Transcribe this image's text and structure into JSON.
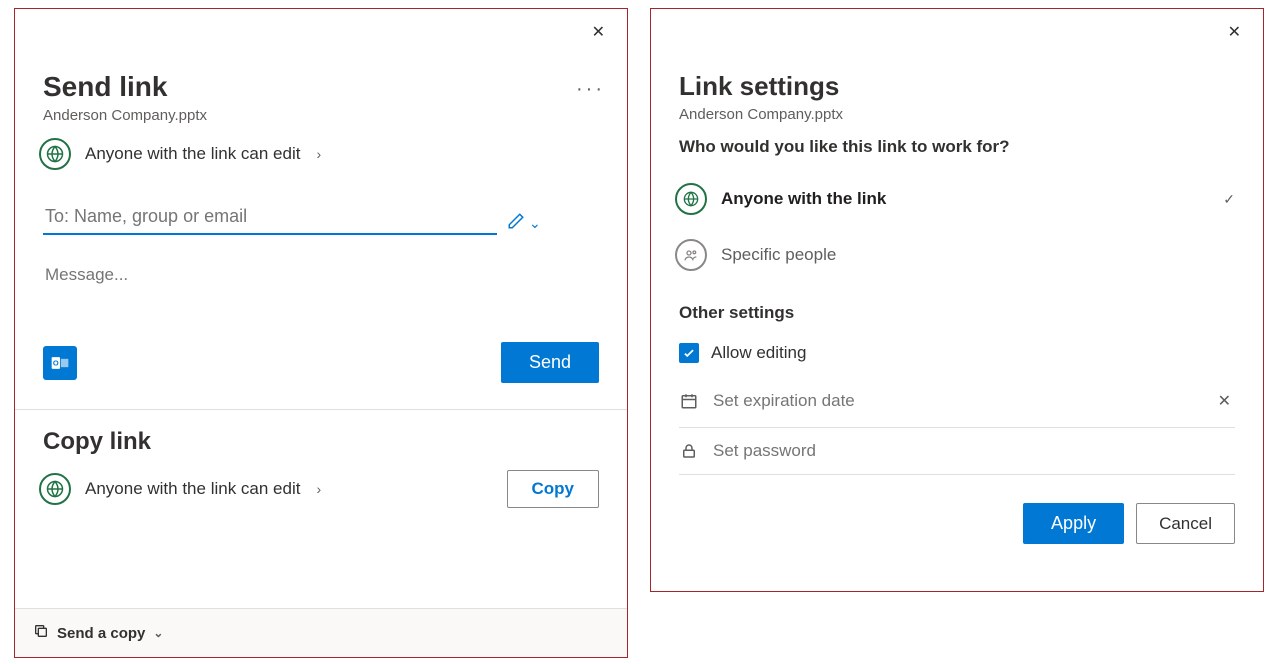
{
  "send": {
    "title": "Send link",
    "filename": "Anderson Company.pptx",
    "perm_text": "Anyone with the link can edit",
    "to_placeholder": "To: Name, group or email",
    "message_placeholder": "Message...",
    "send_button": "Send",
    "copy_title": "Copy link",
    "copy_perm_text": "Anyone with the link can edit",
    "copy_button": "Copy",
    "footer_label": "Send a copy"
  },
  "settings": {
    "title": "Link settings",
    "filename": "Anderson Company.pptx",
    "question": "Who would you like this link to work for?",
    "option_anyone": "Anyone with the link",
    "option_specific": "Specific people",
    "other_title": "Other settings",
    "allow_editing": "Allow editing",
    "expiration_placeholder": "Set expiration date",
    "password_placeholder": "Set password",
    "apply": "Apply",
    "cancel": "Cancel"
  }
}
